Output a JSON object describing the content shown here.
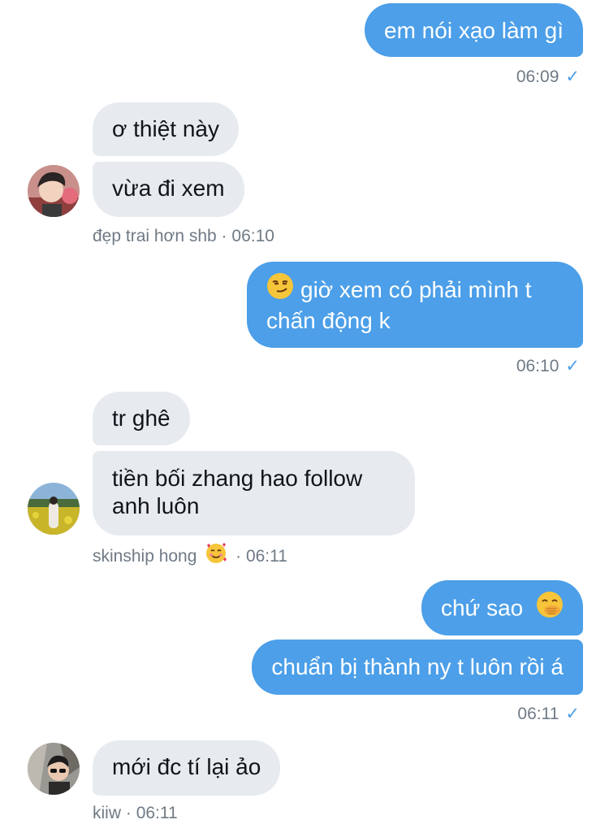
{
  "messages": {
    "m1": {
      "text": "em nói xạo làm gì",
      "time": "06:09",
      "check": "✓"
    },
    "m2": {
      "text": "ơ thiệt này"
    },
    "m3": {
      "text": "vừa đi xem"
    },
    "m3_meta": {
      "sender": "đẹp trai hơn shb",
      "sep": "·",
      "time": "06:10"
    },
    "m4": {
      "emoji": "smirking-face",
      "line1": "giờ xem có phải mình t",
      "line2": "chấn động k",
      "time": "06:10",
      "check": "✓"
    },
    "m5": {
      "text": "tr ghê"
    },
    "m6": {
      "line1": "tiền bối zhang hao follow",
      "line2": "anh luôn"
    },
    "m6_meta": {
      "sender": "skinship hong",
      "emoji": "smiling-face-with-hearts",
      "sep": "·",
      "time": "06:11"
    },
    "m7": {
      "text": "chứ sao",
      "emoji": "face-with-hand-over-mouth"
    },
    "m8": {
      "text": "chuẩn bị thành ny t luôn rồi á",
      "time": "06:11",
      "check": "✓"
    },
    "m9": {
      "text": "mới đc tí lại ảo"
    },
    "m9_meta": {
      "sender": "kiiw",
      "sep": "·",
      "time": "06:11"
    }
  },
  "colors": {
    "outgoing_bubble": "#4c9fe8",
    "incoming_bubble": "#e7ebf0",
    "meta_text": "#6f7a85",
    "check": "#4c9fe8"
  }
}
